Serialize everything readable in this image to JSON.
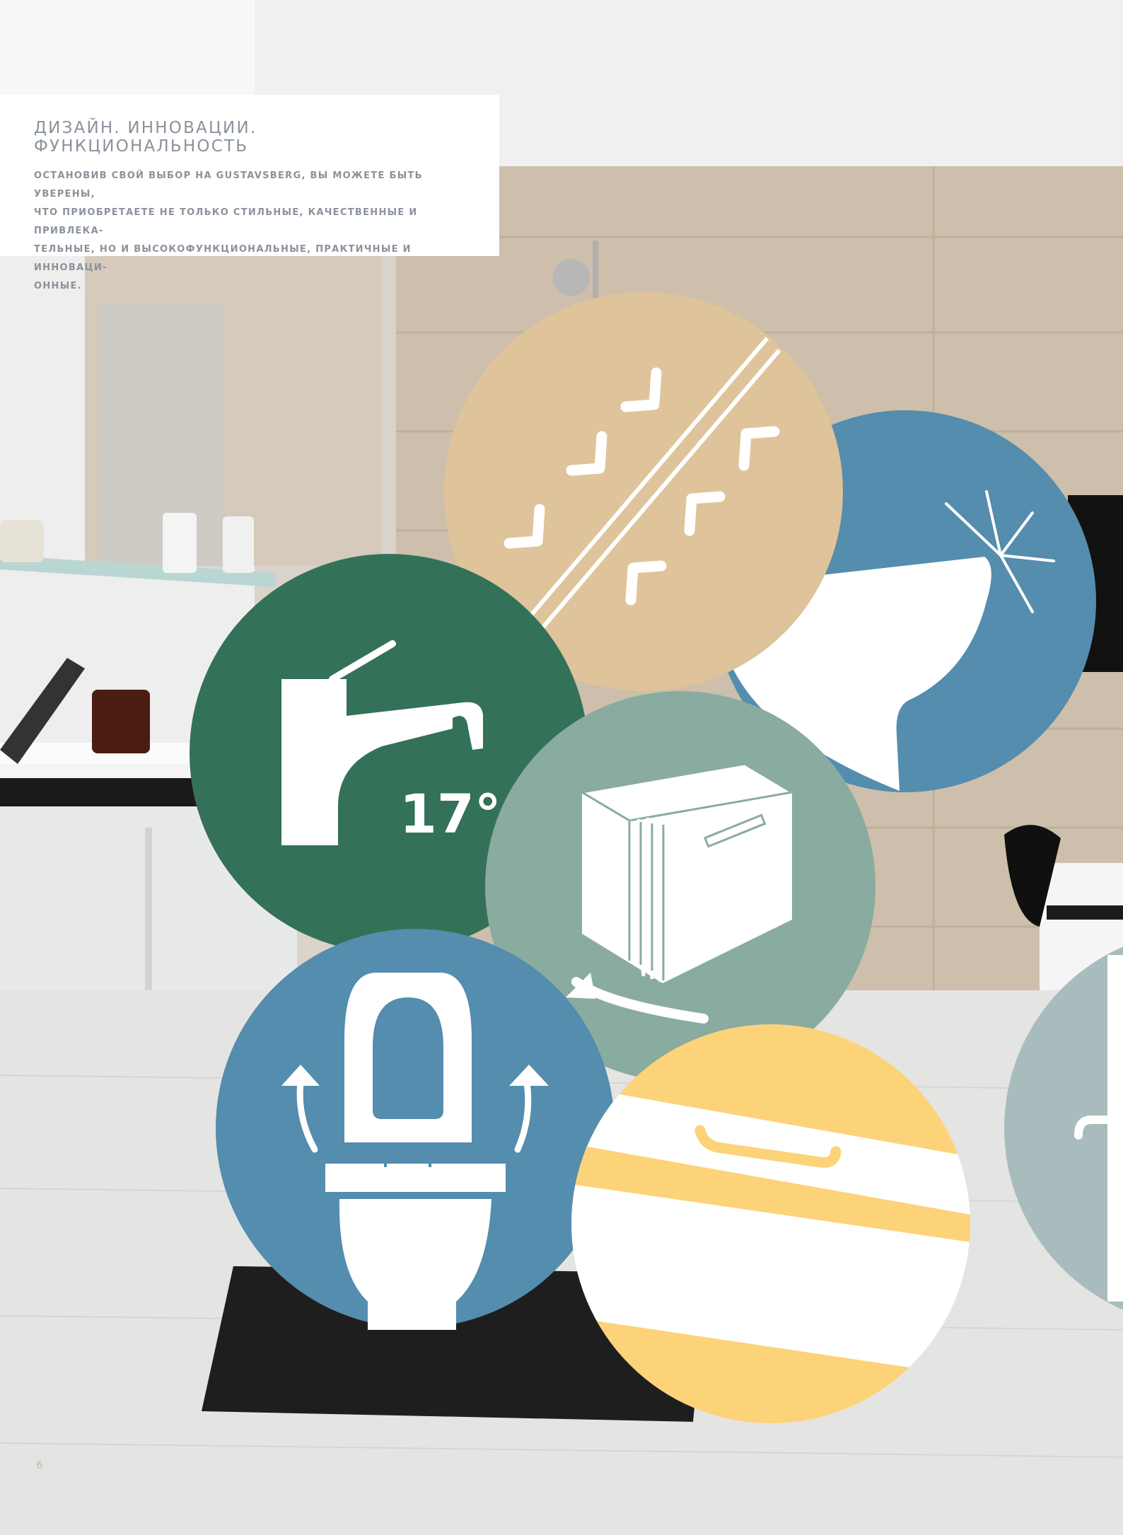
{
  "intro": {
    "title": "ДИЗАЙН. ИННОВАЦИИ. ФУНКЦИОНАЛЬНОСТЬ",
    "text_lines": [
      "ОСТАНОВИВ СВОЙ ВЫБОР НА GUSTAVSBERG, ВЫ МОЖЕТЕ БЫТЬ УВЕРЕНЫ,",
      "ЧТО ПРИОБРЕТАЕТЕ НЕ ТОЛЬКО СТИЛЬНЫЕ, КАЧЕСТВЕННЫЕ И ПРИВЛЕКА-",
      "ТЕЛЬНЫЕ, НО И ВЫСОКОФУНКЦИОНАЛЬНЫЕ, ПРАКТИЧНЫЕ И ИННОВАЦИ-",
      "ОННЫЕ."
    ]
  },
  "feature_icons": [
    {
      "name": "anti-slip-icon",
      "color": "#dfc39a"
    },
    {
      "name": "rimless-toilet-icon",
      "color": "#548dad"
    },
    {
      "name": "faucet-angle-icon",
      "color": "#337159",
      "label": "17°"
    },
    {
      "name": "soft-close-drawer-icon",
      "color": "#8aab9f"
    },
    {
      "name": "removable-seat-icon",
      "color": "#548dad"
    },
    {
      "name": "drawer-handle-icon",
      "color": "#fdd37a"
    },
    {
      "name": "partial-circle-icon",
      "color": "#a8bcbd"
    }
  ],
  "page_number": "6"
}
